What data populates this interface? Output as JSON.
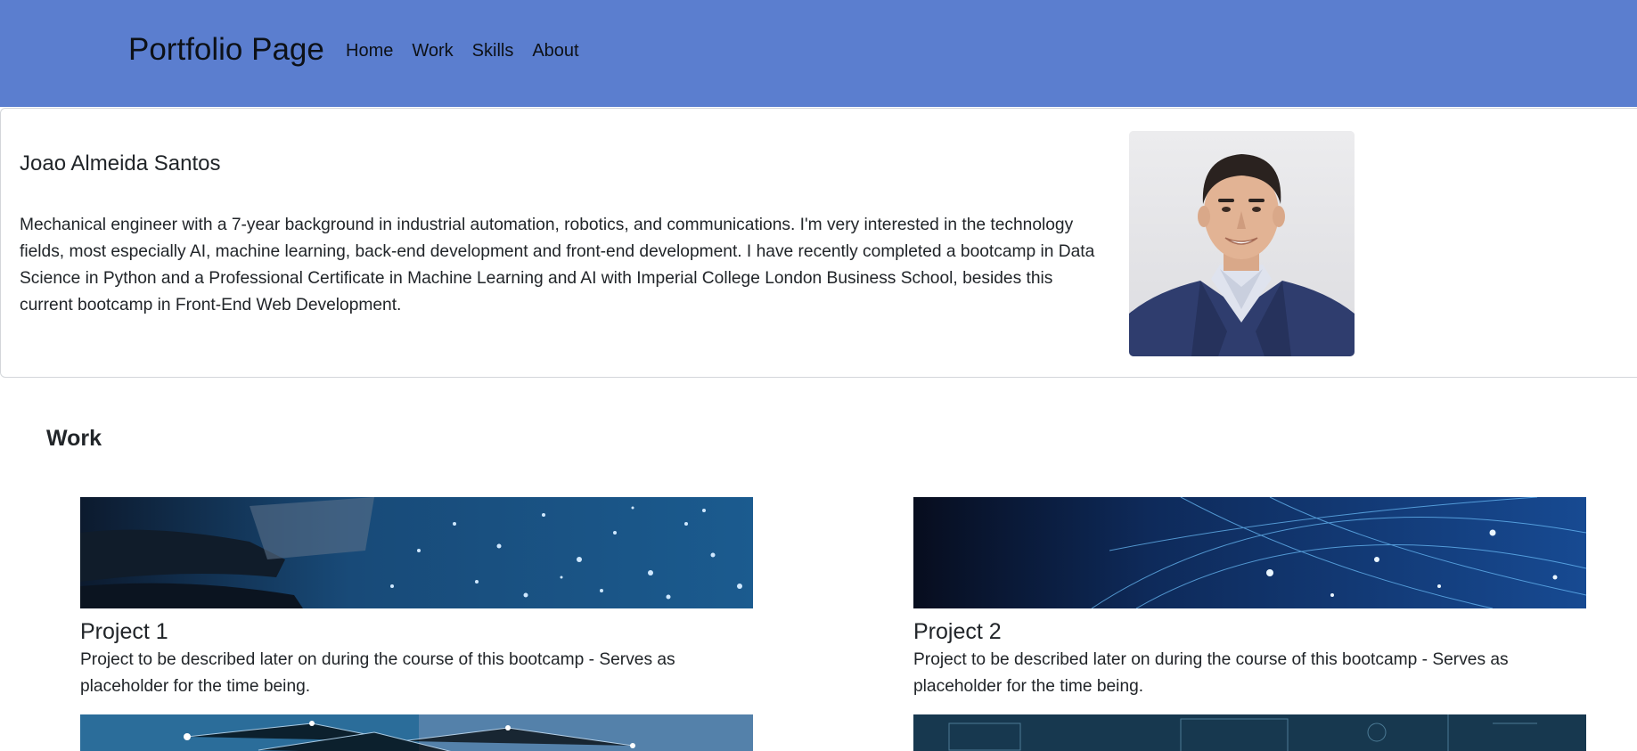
{
  "navbar": {
    "brand": "Portfolio Page",
    "links": [
      "Home",
      "Work",
      "Skills",
      "About"
    ],
    "background": "#5b7ecf"
  },
  "hero": {
    "name": "Joao Almeida Santos",
    "bio": "Mechanical engineer with a 7-year background in industrial automation, robotics, and communications. I'm very interested in the technology fields, most especially AI, machine learning, back-end development and front-end development. I have recently completed a bootcamp in Data Science in Python and a Professional Certificate in Machine Learning and AI with Imperial College London Business School, besides this current bootcamp in Front-End Web Development."
  },
  "work": {
    "heading": "Work",
    "projects": [
      {
        "title": "Project 1",
        "description": "Project to be described later on during the course of this bootcamp - Serves as placeholder for the time being."
      },
      {
        "title": "Project 2",
        "description": "Project to be described later on during the course of this bootcamp - Serves as placeholder for the time being."
      }
    ]
  }
}
